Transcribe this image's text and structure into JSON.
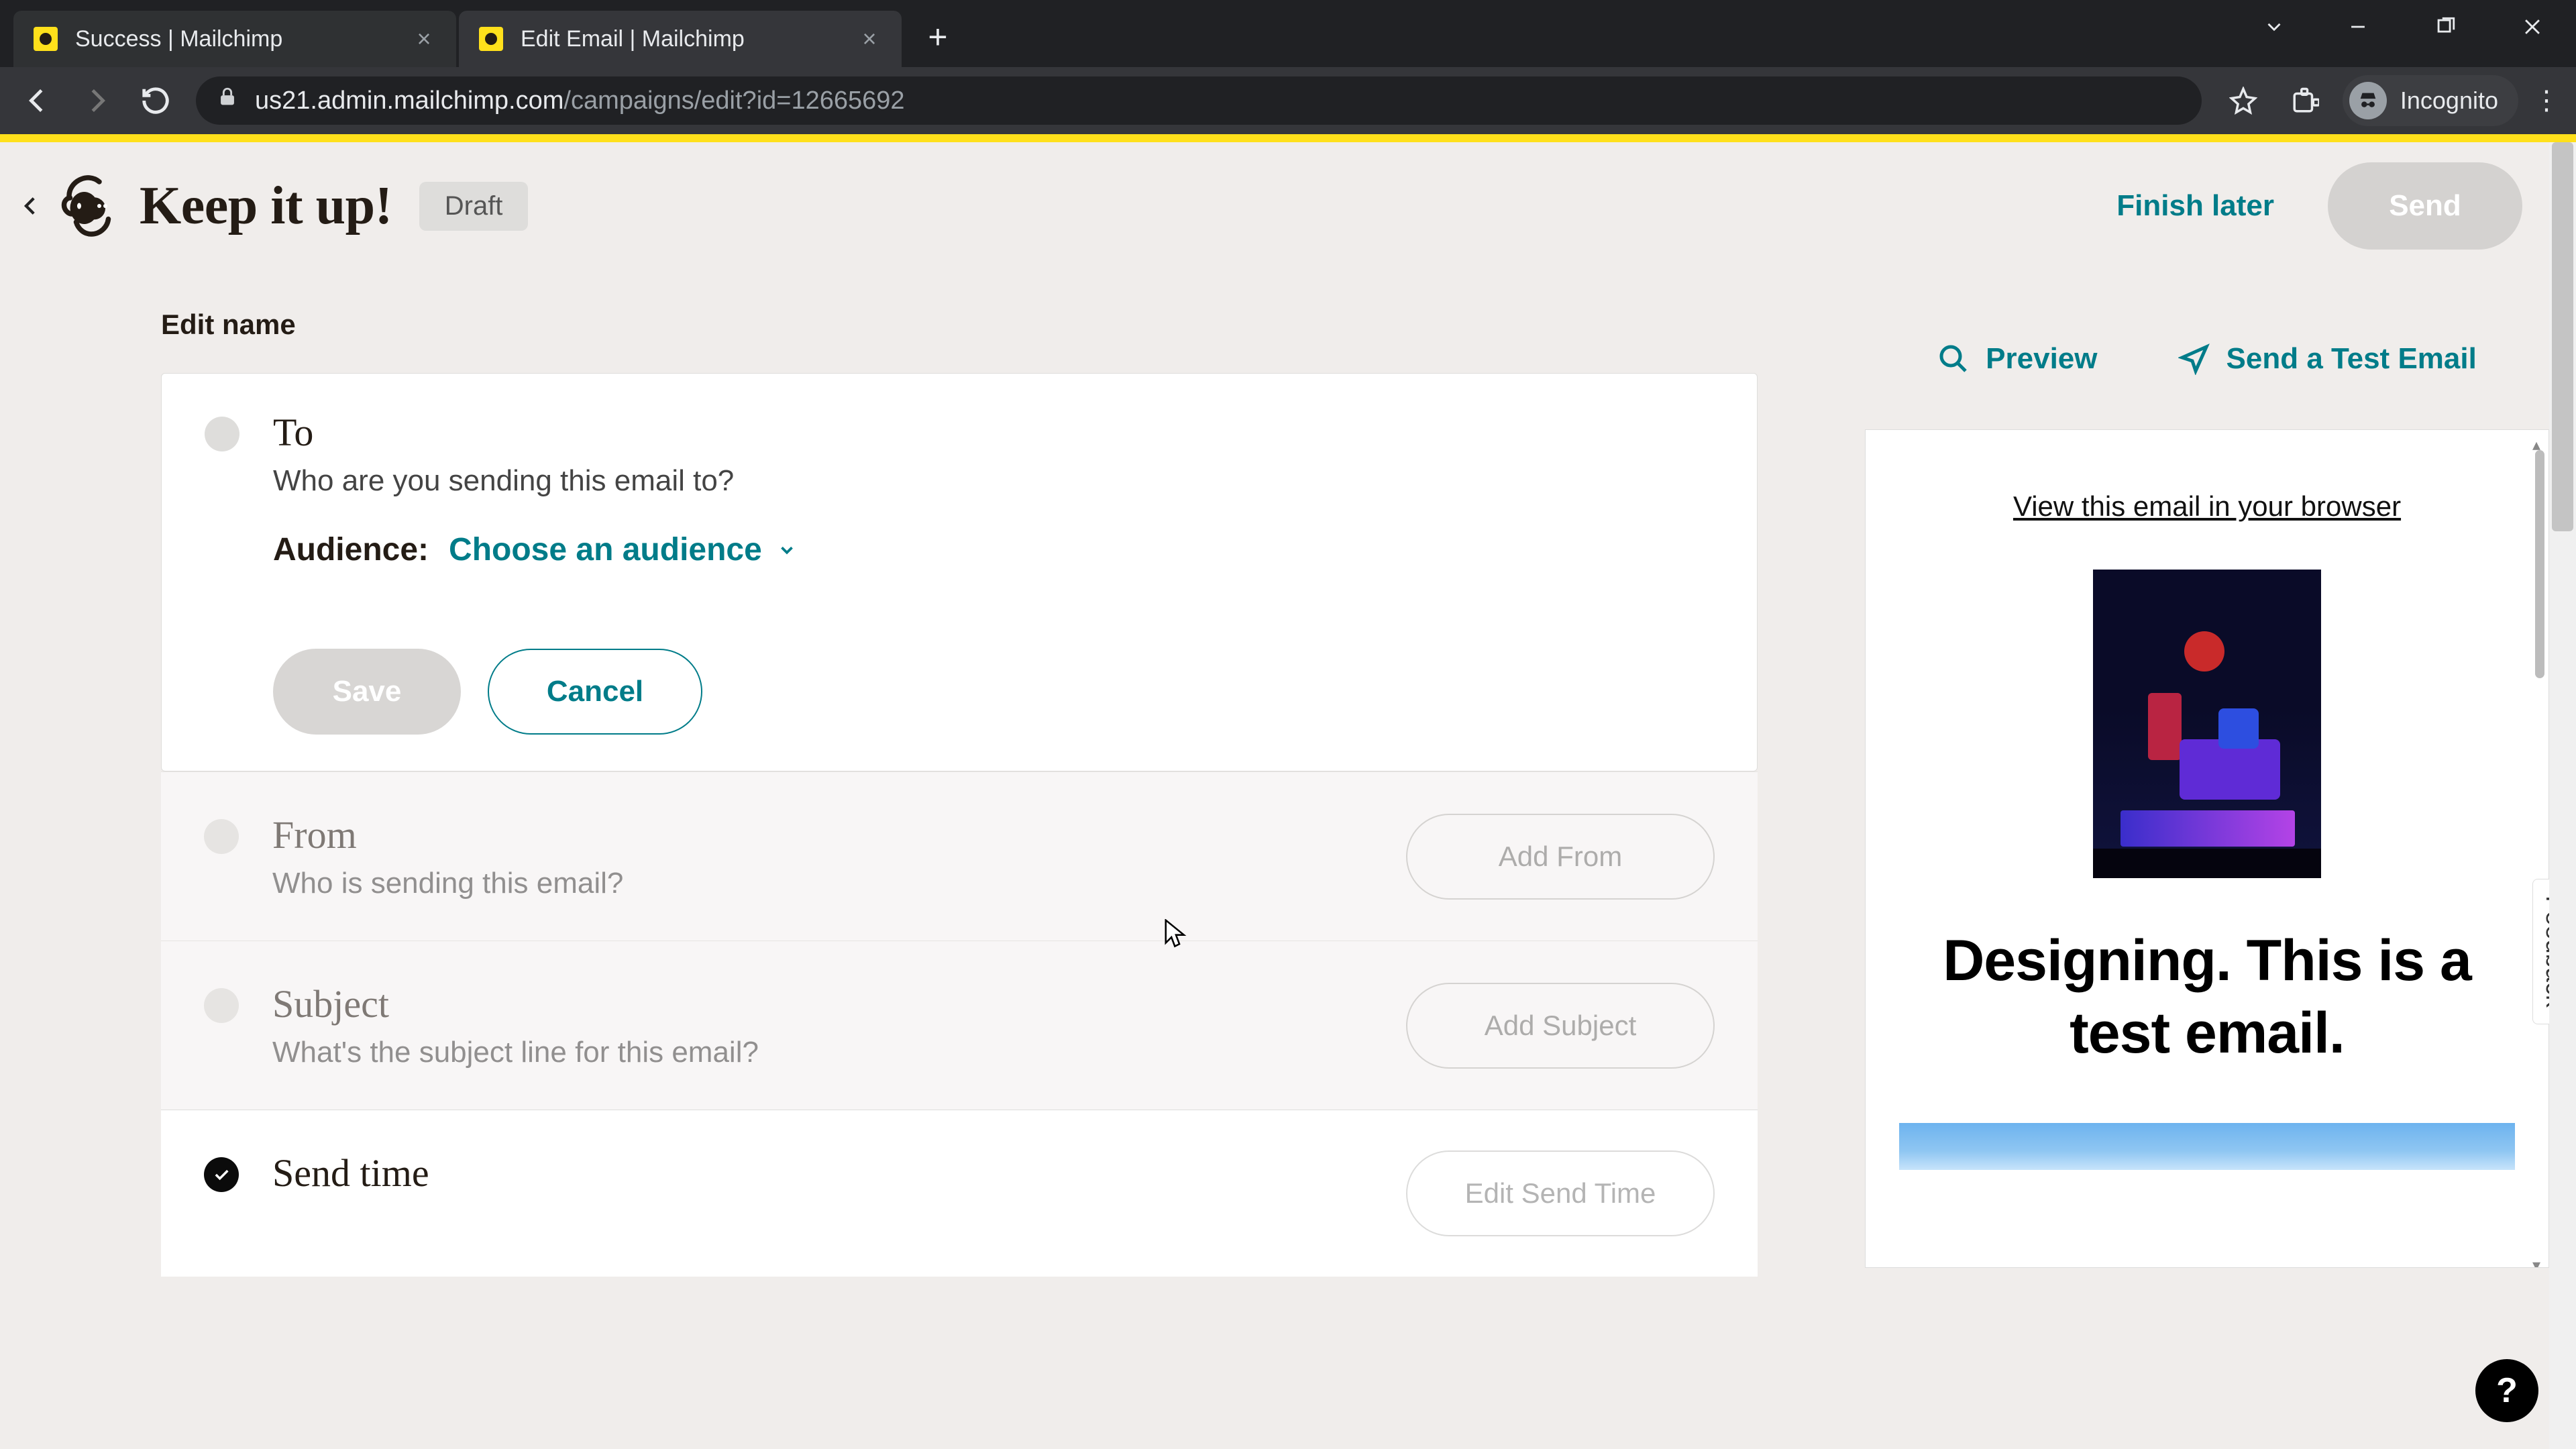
{
  "browser": {
    "tabs": [
      {
        "title": "Success | Mailchimp",
        "active": false
      },
      {
        "title": "Edit Email | Mailchimp",
        "active": true
      }
    ],
    "url_host": "us21.admin.mailchimp.com",
    "url_path": "/campaigns/edit?id=12665692",
    "incognito_label": "Incognito"
  },
  "header": {
    "campaign_name": "Keep it up!",
    "status": "Draft",
    "finish_label": "Finish later",
    "send_label": "Send"
  },
  "edit_name_link": "Edit name",
  "to": {
    "title": "To",
    "subtitle": "Who are you sending this email to?",
    "audience_label": "Audience:",
    "audience_action": "Choose an audience",
    "save_label": "Save",
    "cancel_label": "Cancel"
  },
  "from": {
    "title": "From",
    "subtitle": "Who is sending this email?",
    "button": "Add From"
  },
  "subject": {
    "title": "Subject",
    "subtitle": "What's the subject line for this email?",
    "button": "Add Subject"
  },
  "sendtime": {
    "title": "Send time",
    "button": "Edit Send Time"
  },
  "preview": {
    "preview_label": "Preview",
    "test_label": "Send a Test Email",
    "browser_link": "View this email in your browser",
    "headline": "Designing. This is a test email."
  },
  "feedback": "Feedback",
  "help": "?"
}
